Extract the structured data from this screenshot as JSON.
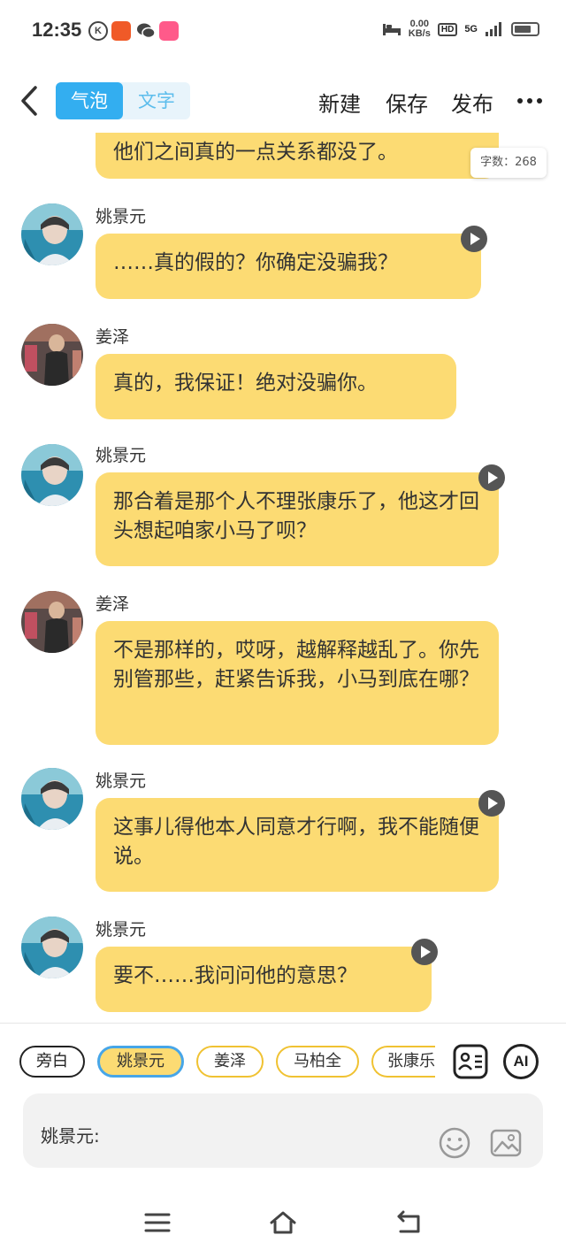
{
  "status_bar": {
    "time": "12:35",
    "k_badge": "K",
    "net_speed_value": "0.00",
    "net_speed_unit": "KB/s",
    "hd": "HD",
    "signal": "5G"
  },
  "header": {
    "tabs": [
      {
        "label": "气泡",
        "active": true
      },
      {
        "label": "文字",
        "active": false
      }
    ],
    "new_label": "新建",
    "save_label": "保存",
    "publish_label": "发布",
    "more_icon": "more-dots-icon"
  },
  "word_count": "字数：268",
  "messages": [
    {
      "sender": "",
      "text": "他们之间真的一点关系都没了。",
      "play": false
    },
    {
      "sender": "姚景元",
      "text": "……真的假的？你确定没骗我？",
      "play": true
    },
    {
      "sender": "姜泽",
      "text": "真的，我保证！绝对没骗你。",
      "play": false
    },
    {
      "sender": "姚景元",
      "text": "那合着是那个人不理张康乐了，他这才回头想起咱家小马了呗？",
      "play": true
    },
    {
      "sender": "姜泽",
      "text": "不是那样的，哎呀，越解释越乱了。你先别管那些，赶紧告诉我，小马到底在哪？",
      "play": false
    },
    {
      "sender": "姚景元",
      "text": "这事儿得他本人同意才行啊，我不能随便说。",
      "play": true
    },
    {
      "sender": "姚景元",
      "text": "要不……我问问他的意思？",
      "play": true
    }
  ],
  "characters": [
    "旁白",
    "姚景元",
    "姜泽",
    "马柏全",
    "张康乐"
  ],
  "selected_character": "姚景元",
  "input_label": "姚景元:",
  "tools": {
    "ai_label": "AI"
  },
  "colors": {
    "bubble": "#fcdb73",
    "accent": "#33aef0",
    "chip_border": "#f0c232",
    "selected_border": "#47a6e8"
  }
}
